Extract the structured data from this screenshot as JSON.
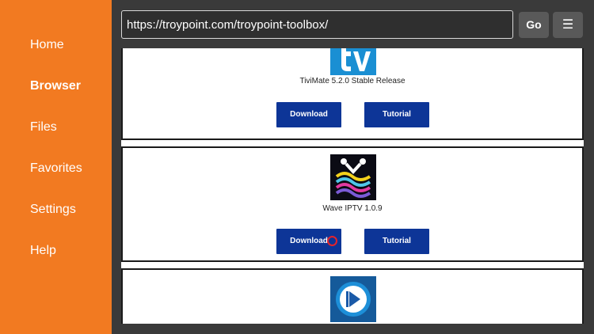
{
  "sidebar": {
    "items": [
      {
        "label": "Home",
        "active": false
      },
      {
        "label": "Browser",
        "active": true
      },
      {
        "label": "Files",
        "active": false
      },
      {
        "label": "Favorites",
        "active": false
      },
      {
        "label": "Settings",
        "active": false
      },
      {
        "label": "Help",
        "active": false
      }
    ]
  },
  "toolbar": {
    "url": "https://troypoint.com/troypoint-toolbox/",
    "go_label": "Go",
    "menu_icon": "hamburger-icon",
    "menu_glyph": "☰"
  },
  "page": {
    "cards": [
      {
        "title": "TiviMate 5.2.0 Stable Release",
        "icon": "tivimate-logo-icon",
        "download_label": "Download",
        "tutorial_label": "Tutorial"
      },
      {
        "title": "Wave IPTV 1.0.9",
        "icon": "wave-iptv-logo-icon",
        "download_label": "Download",
        "tutorial_label": "Tutorial"
      },
      {
        "icon": "play-logo-icon"
      }
    ]
  },
  "colors": {
    "sidebar_bg": "#f27a21",
    "main_bg": "#3a3a3a",
    "button_blue": "#0d3597",
    "cursor_ring": "#e5232b"
  }
}
